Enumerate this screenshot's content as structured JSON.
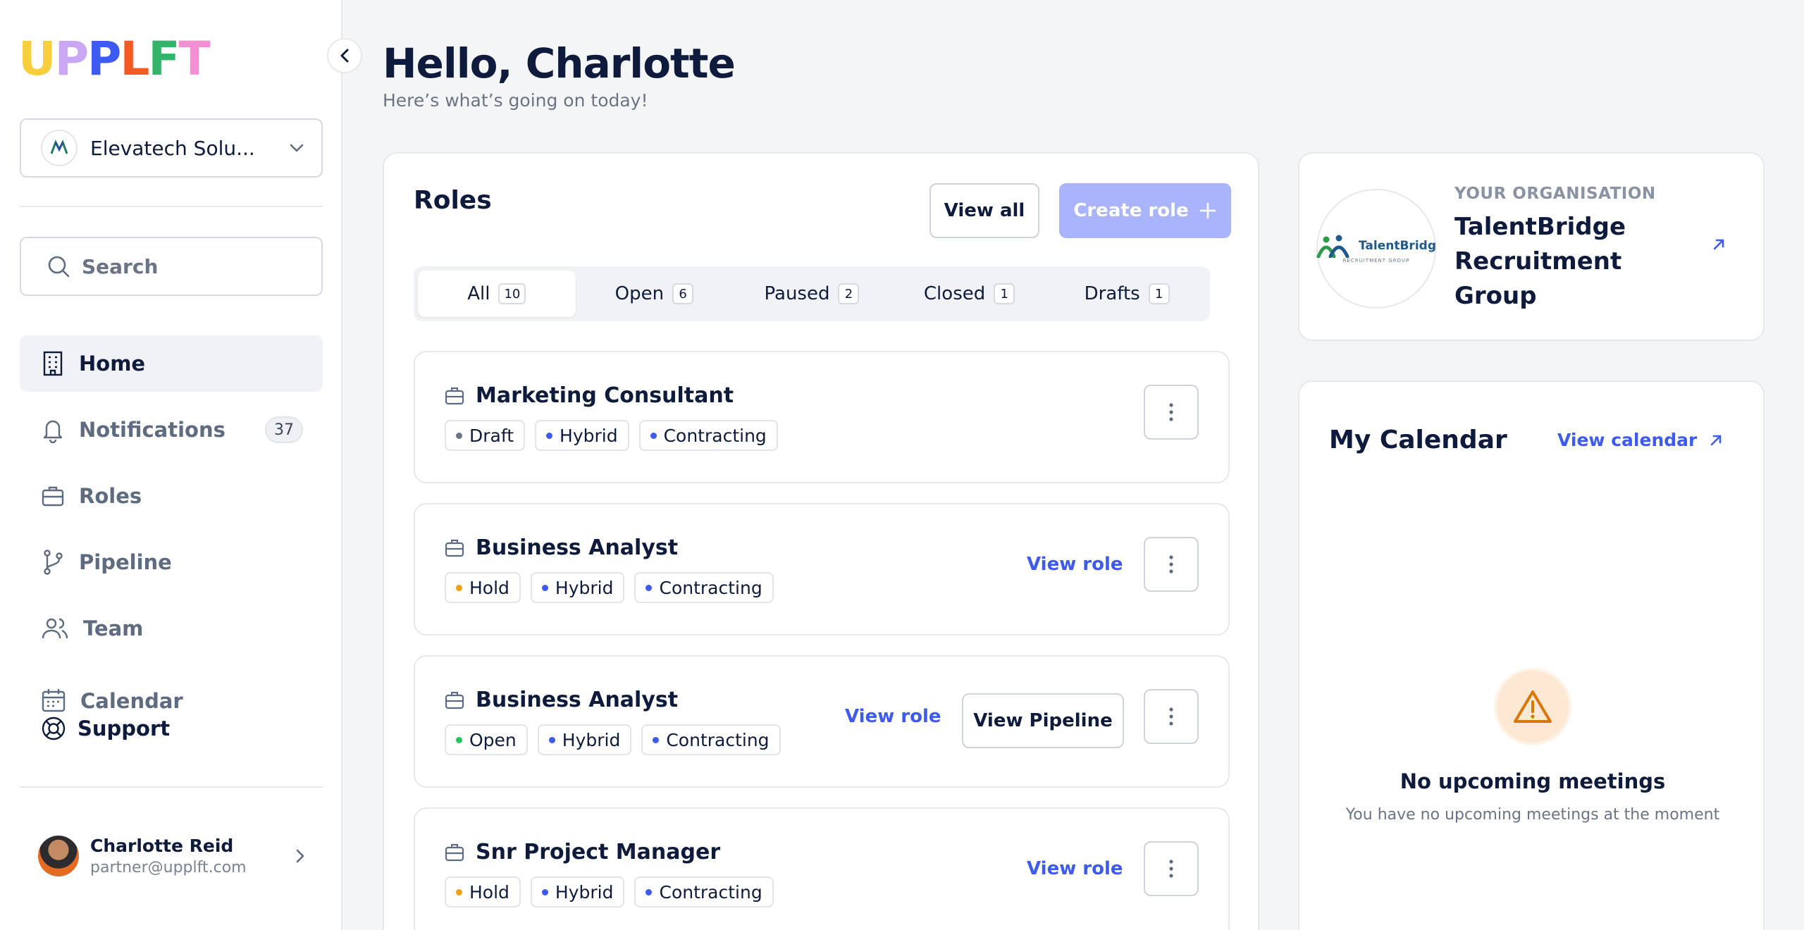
{
  "brand": {
    "logo_letters": [
      {
        "ch": "U",
        "color": "#f7cf3e"
      },
      {
        "ch": "P",
        "color": "#c9a7f5"
      },
      {
        "ch": "P",
        "color": "#3d5af1"
      },
      {
        "ch": "L",
        "color": "#f25a23"
      },
      {
        "ch": "F",
        "color": "#34b36b"
      },
      {
        "ch": "T",
        "color": "#f48fd4"
      }
    ]
  },
  "sidebar": {
    "org_select": {
      "value": "Elevatech Solu..."
    },
    "search": {
      "placeholder": "Search"
    },
    "items": [
      {
        "label": "Home",
        "icon": "building-icon",
        "active": true
      },
      {
        "label": "Notifications",
        "icon": "bell-icon",
        "badge": "37"
      },
      {
        "label": "Roles",
        "icon": "briefcase-icon"
      },
      {
        "label": "Pipeline",
        "icon": "git-branch-icon"
      },
      {
        "label": "Team",
        "icon": "users-icon"
      },
      {
        "label": "Calendar",
        "icon": "calendar-icon"
      }
    ],
    "support": {
      "label": "Support",
      "icon": "lifebuoy-icon"
    },
    "user": {
      "name": "Charlotte Reid",
      "email": "partner@upplft.com"
    }
  },
  "header": {
    "title": "Hello, Charlotte",
    "subtitle": "Here’s what’s going on today!"
  },
  "roles": {
    "title": "Roles",
    "view_all": "View all",
    "create": "Create role",
    "filters": [
      {
        "label": "All",
        "count": "10",
        "active": true
      },
      {
        "label": "Open",
        "count": "6"
      },
      {
        "label": "Paused",
        "count": "2"
      },
      {
        "label": "Closed",
        "count": "1"
      },
      {
        "label": "Drafts",
        "count": "1"
      }
    ],
    "items": [
      {
        "title": "Marketing Consultant",
        "tags": [
          {
            "label": "Draft",
            "color": "#6b7485"
          },
          {
            "label": "Hybrid",
            "color": "#3d5af1"
          },
          {
            "label": "Contracting",
            "color": "#3d5af1"
          }
        ]
      },
      {
        "title": "Business Analyst",
        "view_role": "View role",
        "tags": [
          {
            "label": "Hold",
            "color": "#f59e0b"
          },
          {
            "label": "Hybrid",
            "color": "#3d5af1"
          },
          {
            "label": "Contracting",
            "color": "#3d5af1"
          }
        ]
      },
      {
        "title": "Business Analyst",
        "view_role": "View role",
        "view_pipeline": "View Pipeline",
        "tags": [
          {
            "label": "Open",
            "color": "#22c55e"
          },
          {
            "label": "Hybrid",
            "color": "#3d5af1"
          },
          {
            "label": "Contracting",
            "color": "#3d5af1"
          }
        ]
      },
      {
        "title": "Snr Project Manager",
        "view_role": "View role",
        "tags": [
          {
            "label": "Hold",
            "color": "#f59e0b"
          },
          {
            "label": "Hybrid",
            "color": "#3d5af1"
          },
          {
            "label": "Contracting",
            "color": "#3d5af1"
          }
        ]
      }
    ]
  },
  "organisation": {
    "eyebrow": "YOUR ORGANISATION",
    "name": "TalentBridge Recruitment Group",
    "logo_text": "TalentBridg",
    "logo_sub": "RECRUITMENT GROUP"
  },
  "calendar": {
    "title": "My Calendar",
    "link": "View calendar",
    "empty_title": "No upcoming meetings",
    "empty_sub": "You have no upcoming meetings at the moment"
  },
  "colors": {
    "accent": "#3d5af1",
    "accent_light": "#a9b4fb",
    "warning": "#d97706"
  }
}
